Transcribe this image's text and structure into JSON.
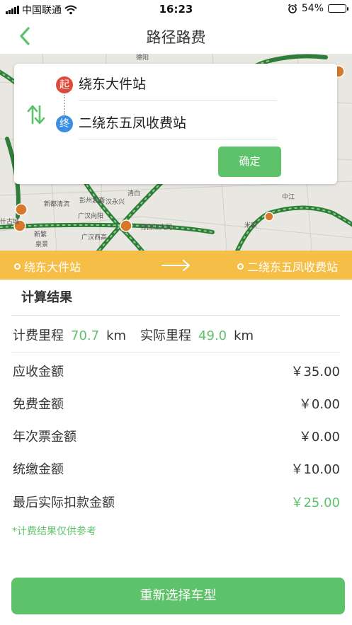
{
  "status_bar": {
    "carrier": "中国联通",
    "time": "16:23",
    "battery": "54%",
    "battery_level": 0.54,
    "icons": [
      "signal-icon",
      "wifi-icon",
      "alarm-icon",
      "battery-icon"
    ]
  },
  "nav": {
    "title": "路径路费",
    "back_icon": "chevron-left-icon"
  },
  "map_labels": [
    "新都清流",
    "彭州复高",
    "广汉永兴",
    "广汉向阳",
    "广汉西高",
    "新繁",
    "泉景",
    "青白江大同",
    "中江",
    "米家",
    "清白",
    "德阳",
    "什古城"
  ],
  "search": {
    "start_badge": "起",
    "end_badge": "终",
    "start_station": "绕东大件站",
    "end_station": "二绕东五凤收费站",
    "confirm_label": "确定"
  },
  "route": {
    "from": "绕东大件站",
    "to": "二绕东五凤收费站"
  },
  "results": {
    "section_title": "计算结果",
    "billing_mileage_label": "计费里程",
    "billing_mileage_value": "70.7",
    "actual_mileage_label": "实际里程",
    "actual_mileage_value": "49.0",
    "unit": "km",
    "rows": [
      {
        "label": "应收金额",
        "value": "￥35.00"
      },
      {
        "label": "免费金额",
        "value": "￥0.00"
      },
      {
        "label": "年次票金额",
        "value": "￥0.00"
      },
      {
        "label": "统缴金额",
        "value": "￥10.00"
      },
      {
        "label": "最后实际扣款金额",
        "value": "￥25.00"
      }
    ],
    "note": "*计费结果仅供参考"
  },
  "bottom_button": "重新选择车型",
  "colors": {
    "accent_green": "#5ec26a",
    "route_strip": "#f4be47",
    "start_badge": "#e04a3b",
    "end_badge": "#3a8fe3",
    "road_green": "#2e7d32"
  }
}
